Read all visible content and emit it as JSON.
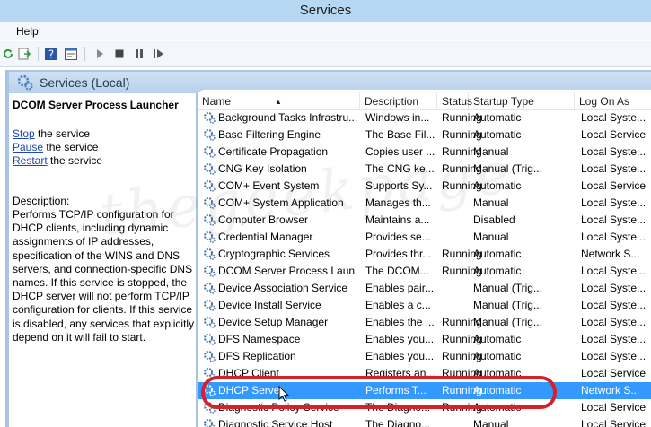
{
  "window": {
    "title": "Services"
  },
  "menu": {
    "help": "Help"
  },
  "pane": {
    "title": "Services (Local)"
  },
  "details": {
    "service_name": "DCOM Server Process Launcher",
    "actions": [
      {
        "link": "Stop",
        "rest": " the service"
      },
      {
        "link": "Pause",
        "rest": " the service"
      },
      {
        "link": "Restart",
        "rest": " the service"
      }
    ],
    "description_label": "Description:",
    "description": "Performs TCP/IP configuration for DHCP clients, including dynamic assignments of IP addresses, specification of the WINS and DNS servers, and connection-specific DNS names. If this service is stopped, the DHCP server will not perform TCP/IP configuration for clients. If this service is disabled, any services that explicitly depend on it will fail to start."
  },
  "columns": [
    "Name",
    "Description",
    "Status",
    "Startup Type",
    "Log On As"
  ],
  "rows": [
    {
      "name": "Background Tasks Infrastru...",
      "description": "Windows in...",
      "status": "Running",
      "startup": "Automatic",
      "logon": "Local Syste..."
    },
    {
      "name": "Base Filtering Engine",
      "description": "The Base Fil...",
      "status": "Running",
      "startup": "Automatic",
      "logon": "Local Service"
    },
    {
      "name": "Certificate Propagation",
      "description": "Copies user ...",
      "status": "Running",
      "startup": "Manual",
      "logon": "Local Syste..."
    },
    {
      "name": "CNG Key Isolation",
      "description": "The CNG ke...",
      "status": "Running",
      "startup": "Manual (Trig...",
      "logon": "Local Syste..."
    },
    {
      "name": "COM+ Event System",
      "description": "Supports Sy...",
      "status": "Running",
      "startup": "Automatic",
      "logon": "Local Service"
    },
    {
      "name": "COM+ System Application",
      "description": "Manages th...",
      "status": "",
      "startup": "Manual",
      "logon": "Local Syste..."
    },
    {
      "name": "Computer Browser",
      "description": "Maintains a...",
      "status": "",
      "startup": "Disabled",
      "logon": "Local Syste..."
    },
    {
      "name": "Credential Manager",
      "description": "Provides se...",
      "status": "",
      "startup": "Manual",
      "logon": "Local Syste..."
    },
    {
      "name": "Cryptographic Services",
      "description": "Provides thr...",
      "status": "Running",
      "startup": "Automatic",
      "logon": "Network S..."
    },
    {
      "name": "DCOM Server Process Laun...",
      "description": "The DCOM...",
      "status": "Running",
      "startup": "Automatic",
      "logon": "Local Syste..."
    },
    {
      "name": "Device Association Service",
      "description": "Enables pair...",
      "status": "",
      "startup": "Manual (Trig...",
      "logon": "Local Syste..."
    },
    {
      "name": "Device Install Service",
      "description": "Enables a c...",
      "status": "",
      "startup": "Manual (Trig...",
      "logon": "Local Syste..."
    },
    {
      "name": "Device Setup Manager",
      "description": "Enables the ...",
      "status": "Running",
      "startup": "Manual (Trig...",
      "logon": "Local Syste..."
    },
    {
      "name": "DFS Namespace",
      "description": "Enables you...",
      "status": "Running",
      "startup": "Automatic",
      "logon": "Local Syste..."
    },
    {
      "name": "DFS Replication",
      "description": "Enables you...",
      "status": "Running",
      "startup": "Automatic",
      "logon": "Local Syste..."
    },
    {
      "name": "DHCP Client",
      "description": "Registers an...",
      "status": "Running",
      "startup": "Automatic",
      "logon": "Local Service"
    },
    {
      "name": "DHCP Server",
      "description": "Performs T...",
      "status": "Running",
      "startup": "Automatic",
      "logon": "Network S...",
      "selected": true
    },
    {
      "name": "Diagnostic Policy Service",
      "description": "The Diagno...",
      "status": "Running",
      "startup": "Automatic",
      "logon": "Local Service"
    },
    {
      "name": "Diagnostic Service Host",
      "description": "The Diagno...",
      "status": "",
      "startup": "Manual",
      "logon": "Local Service"
    }
  ],
  "icons": {
    "refresh": "refresh-icon",
    "export": "export-list-icon",
    "help": "help-icon",
    "properties": "properties-icon",
    "start": "start-service-icon",
    "stop": "stop-service-icon",
    "pause": "pause-service-icon",
    "restart": "restart-service-icon",
    "service": "gear-icon"
  },
  "colors": {
    "title_bar": "#b6d8f2",
    "selection": "#3399ff",
    "link": "#1a49b0",
    "annotation_oval": "#d8202a"
  }
}
